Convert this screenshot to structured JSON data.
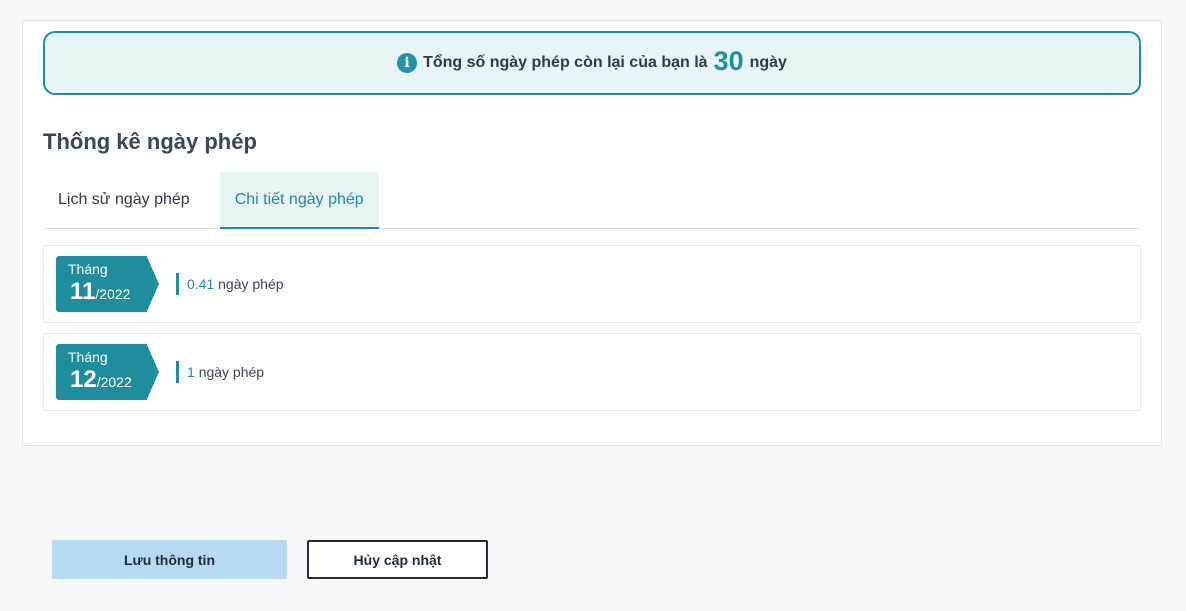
{
  "notice": {
    "icon": "info-icon",
    "prefix": "Tổng số ngày phép còn lại của bạn là",
    "days": "30",
    "suffix": "ngày"
  },
  "section_title": "Thống kê ngày phép",
  "tabs": [
    {
      "label": "Lịch sử ngày phép",
      "active": false
    },
    {
      "label": "Chi tiết ngày phép",
      "active": true
    }
  ],
  "months": [
    {
      "label": "Tháng",
      "month": "11",
      "year": "/2022",
      "value": "0.41",
      "unit": "ngày phép"
    },
    {
      "label": "Tháng",
      "month": "12",
      "year": "/2022",
      "value": "1",
      "unit": "ngày phép"
    }
  ],
  "buttons": {
    "save": "Lưu thông tin",
    "cancel": "Hủy cập nhật"
  },
  "colors": {
    "accent": "#1e8e9e",
    "save_button": "#b6daf1"
  }
}
